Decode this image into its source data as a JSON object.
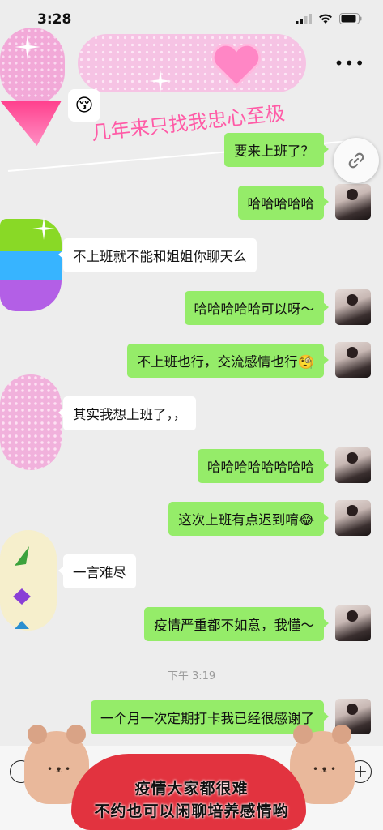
{
  "status_bar": {
    "time": "3:28"
  },
  "header": {
    "more_icon": "ellipsis-icon"
  },
  "overlay": {
    "handwriting": "几年来只找我忠心至极",
    "link_icon": "link-icon",
    "emoji_sticker": "😚",
    "banner_line1": "疫情大家都很难",
    "banner_line2": "不约也可以闲聊培养感情哟"
  },
  "messages": [
    {
      "side": "me",
      "text": "要来上班了？"
    },
    {
      "side": "me",
      "text": "哈哈哈哈哈"
    },
    {
      "side": "other",
      "text": "不上班就不能和姐姐你聊天么"
    },
    {
      "side": "me",
      "text": "哈哈哈哈哈可以呀～"
    },
    {
      "side": "me",
      "text": "不上班也行，交流感情也行🧐"
    },
    {
      "side": "other",
      "text": "其实我想上班了，，"
    },
    {
      "side": "me",
      "text": "哈哈哈哈哈哈哈哈"
    },
    {
      "side": "me",
      "text": "这次上班有点迟到唷😂"
    },
    {
      "side": "other",
      "text": "一言难尽"
    },
    {
      "side": "me",
      "text": "疫情严重都不如意，我懂～"
    },
    {
      "side": "me",
      "text": "一个月一次定期打卡我已经很感谢了"
    }
  ],
  "timestamp": "下午 3:19",
  "colors": {
    "my_bubble": "#95ec69",
    "other_bubble": "#ffffff",
    "background": "#ededed"
  }
}
